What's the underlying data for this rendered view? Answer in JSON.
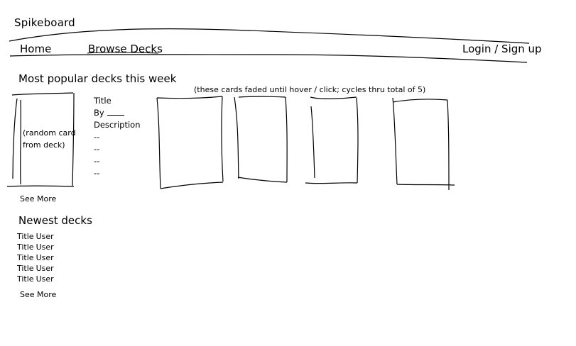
{
  "app": {
    "brand": "Spikeboard"
  },
  "nav": {
    "home": "Home",
    "browse": "Browse Decks",
    "auth": "Login / Sign up"
  },
  "popular": {
    "title": "Most popular decks this week",
    "note": "(these cards faded until hover / click; cycles thru total of 5)",
    "featured_card_text": "(random card from deck)",
    "details": {
      "title": "Title",
      "by_label": "By",
      "description": "Description",
      "lines": [
        "--",
        "--",
        "--",
        "--"
      ]
    },
    "see_more": "See More"
  },
  "newest": {
    "title": "Newest decks",
    "items": [
      {
        "title": "Title",
        "user": "User"
      },
      {
        "title": "Title",
        "user": "User"
      },
      {
        "title": "Title",
        "user": "User"
      },
      {
        "title": "Title",
        "user": "User"
      },
      {
        "title": "Title",
        "user": "User"
      }
    ],
    "see_more": "See More"
  }
}
